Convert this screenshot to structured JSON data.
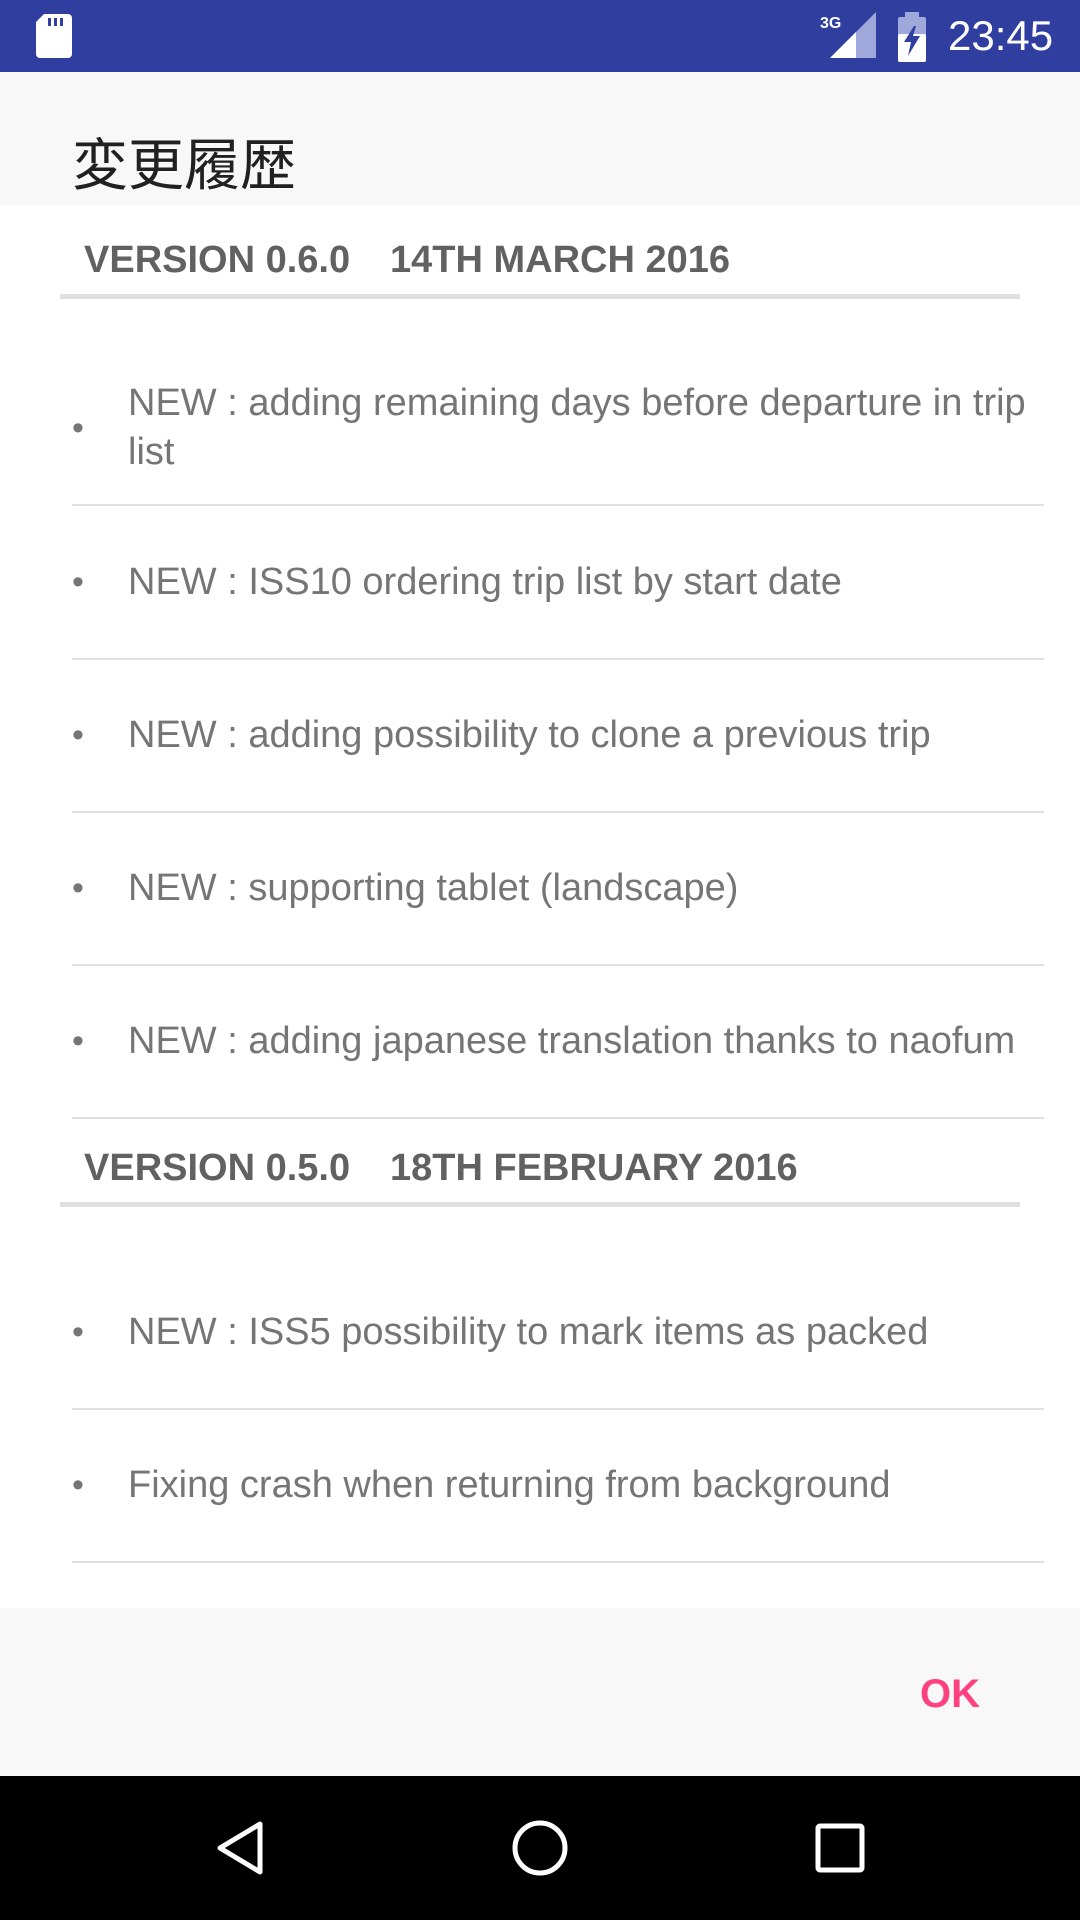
{
  "status_bar": {
    "network": "3G",
    "time": "23:45",
    "icons": [
      "sd-card-icon",
      "signal-icon",
      "battery-charging-icon"
    ]
  },
  "dialog": {
    "title": "変更履歴",
    "versions": [
      {
        "label": "VERSION 0.6.0",
        "date": "14TH MARCH 2016",
        "entries": [
          "NEW : adding remaining days before departure in trip list",
          "NEW : ISS10 ordering trip list by start date",
          "NEW : adding possibility to clone a previous trip",
          "NEW : supporting tablet (landscape)",
          "NEW : adding japanese translation thanks to naofum"
        ]
      },
      {
        "label": "VERSION 0.5.0",
        "date": "18TH FEBRUARY 2016",
        "entries": [
          "NEW : ISS5 possibility to mark items as packed",
          "Fixing crash when returning from background"
        ]
      }
    ],
    "bullet": "•",
    "ok_label": "OK"
  },
  "colors": {
    "status_bar": "#303F9F",
    "accent": "#FF4081",
    "text_secondary": "#757575",
    "header_text": "#616161"
  }
}
